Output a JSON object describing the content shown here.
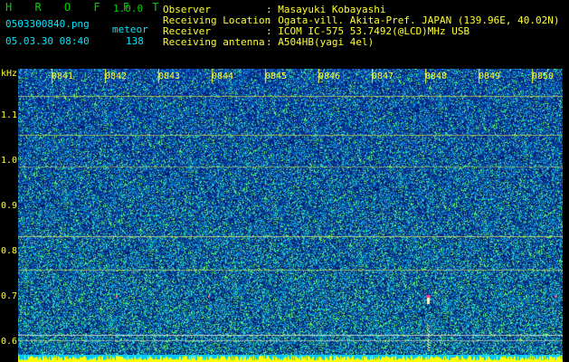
{
  "app": {
    "brand": "H R O F F T",
    "version": "1.0.0",
    "filename": "0503300840.png",
    "datetime": "05.03.30 08:40",
    "mode_label": "meteor",
    "count": "138"
  },
  "info": {
    "rows": [
      {
        "label": "Observer",
        "value": ": Masayuki Kobayashi"
      },
      {
        "label": "Receiving Location",
        "value": ": Ogata-vill. Akita-Pref. JAPAN (139.96E, 40.02N)"
      },
      {
        "label": "Receiver",
        "value": ": ICOM IC-575 53.7492(@LCD)MHz USB"
      },
      {
        "label": "Receiving antenna",
        "value": ": A504HB(yagi 4el)"
      }
    ]
  },
  "axes": {
    "y_unit": "kHz",
    "y_ticks": [
      "1.1",
      "1.0",
      "0.9",
      "0.8",
      "0.7",
      "0.6"
    ],
    "x_ticks": [
      "0841",
      "0842",
      "0843",
      "0844",
      "0845",
      "0846",
      "0847",
      "0848",
      "0849",
      "0850"
    ]
  },
  "colors": {
    "bg": "#000000",
    "text_green": "#00d000",
    "text_yellow": "#ffff30",
    "text_cyan": "#00e8ff",
    "spectrum_base": "#0a1a9a",
    "trace": "#c8d850",
    "baseline": "#ffff00"
  },
  "icons": [
    "none"
  ]
}
